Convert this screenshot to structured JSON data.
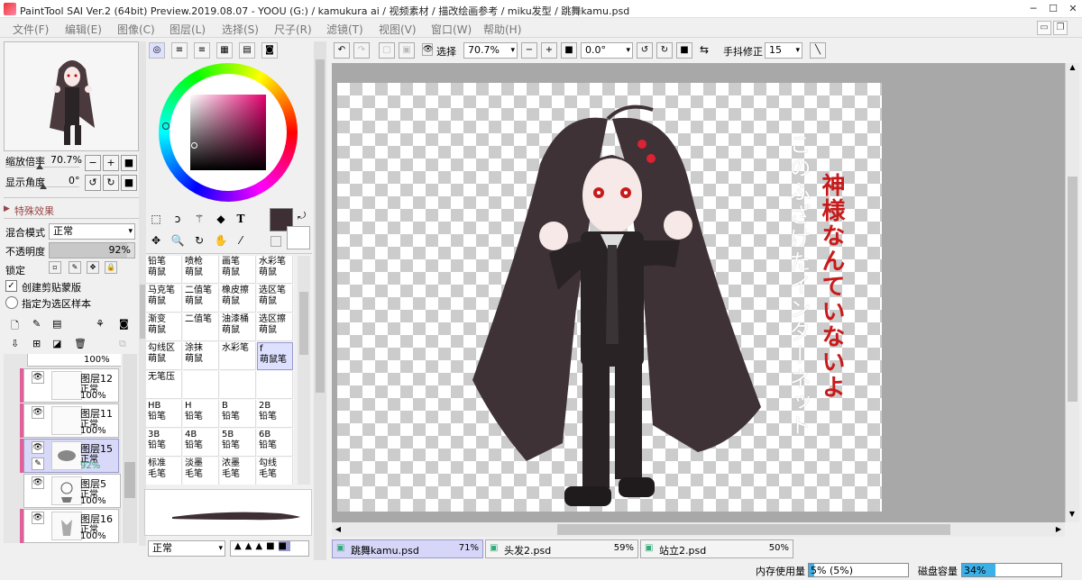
{
  "window": {
    "title": "PaintTool SAI Ver.2 (64bit) Preview.2019.08.07 - YOOU (G:) / kamukura ai / 视频素材 / 描改绘画参考 / miku发型 / 跳舞kamu.psd"
  },
  "menu": [
    "文件(F)",
    "编辑(E)",
    "图像(C)",
    "图层(L)",
    "选择(S)",
    "尺子(R)",
    "滤镜(T)",
    "视图(V)",
    "窗口(W)",
    "帮助(H)"
  ],
  "navigator": {
    "zoom_label": "缩放倍率",
    "zoom_value": "70.7%",
    "angle_label": "显示角度",
    "angle_value": "0°"
  },
  "effects": {
    "header": "特殊效果"
  },
  "layerprops": {
    "blend_label": "混合模式",
    "blend_value": "正常",
    "opacity_label": "不透明度",
    "opacity_value": "92%",
    "opacity": 0.92,
    "lock_label": "锁定",
    "clip_label": "创建剪贴蒙版",
    "sample_label": "指定为选区样本"
  },
  "layers": [
    {
      "name": "",
      "mode": "",
      "opacity": "100%"
    },
    {
      "name": "图层12",
      "mode": "正常",
      "opacity": "100%"
    },
    {
      "name": "图层11",
      "mode": "正常",
      "opacity": "100%"
    },
    {
      "name": "图层15",
      "mode": "正常",
      "opacity": "92%"
    },
    {
      "name": "图层5",
      "mode": "正常",
      "opacity": "100%"
    },
    {
      "name": "图层16",
      "mode": "正常",
      "opacity": "100%"
    }
  ],
  "colors": {
    "primary": "#3d2f33",
    "accent": "#e0609a"
  },
  "brushes": [
    [
      "铅笔\n萌鼠",
      "喷枪\n萌鼠",
      "画笔\n萌鼠",
      "水彩笔\n萌鼠"
    ],
    [
      "马克笔\n萌鼠",
      "二值笔\n萌鼠",
      "橡皮擦\n萌鼠",
      "选区笔\n萌鼠"
    ],
    [
      "渐变\n萌鼠",
      "二值笔",
      "油漆桶\n萌鼠",
      "选区擦\n萌鼠"
    ],
    [
      "勾线区\n萌鼠",
      "涂抹\n萌鼠",
      "水彩笔",
      "f\n萌鼠笔"
    ],
    [
      "无笔压",
      "",
      "",
      ""
    ],
    [
      "HB\n铅笔",
      "H\n铅笔",
      "B\n铅笔",
      "2B\n铅笔"
    ],
    [
      "3B\n铅笔",
      "4B\n铅笔",
      "5B\n铅笔",
      "6B\n铅笔"
    ],
    [
      "标准\n毛笔",
      "淡墨\n毛笔",
      "浓墨\n毛笔",
      "勾线\n毛笔"
    ]
  ],
  "brushmode": "正常",
  "canvastoolbar": {
    "select_label": "选择",
    "zoom": "70.7%",
    "angle": "0.0°",
    "stab_label": "手抖修正",
    "stab_value": "15"
  },
  "canvas_text": {
    "line1": "このふざけたインターネット",
    "line2": "神様なんていないよ"
  },
  "docs": [
    {
      "name": "跳舞kamu.psd",
      "pct": "71%"
    },
    {
      "name": "头发2.psd",
      "pct": "59%"
    },
    {
      "name": "站立2.psd",
      "pct": "50%"
    }
  ],
  "status": {
    "mem_label": "内存使用量",
    "mem_value": "5% (5%)",
    "mem": 0.05,
    "disk_label": "磁盘容量",
    "disk_value": "34%",
    "disk": 0.34
  }
}
